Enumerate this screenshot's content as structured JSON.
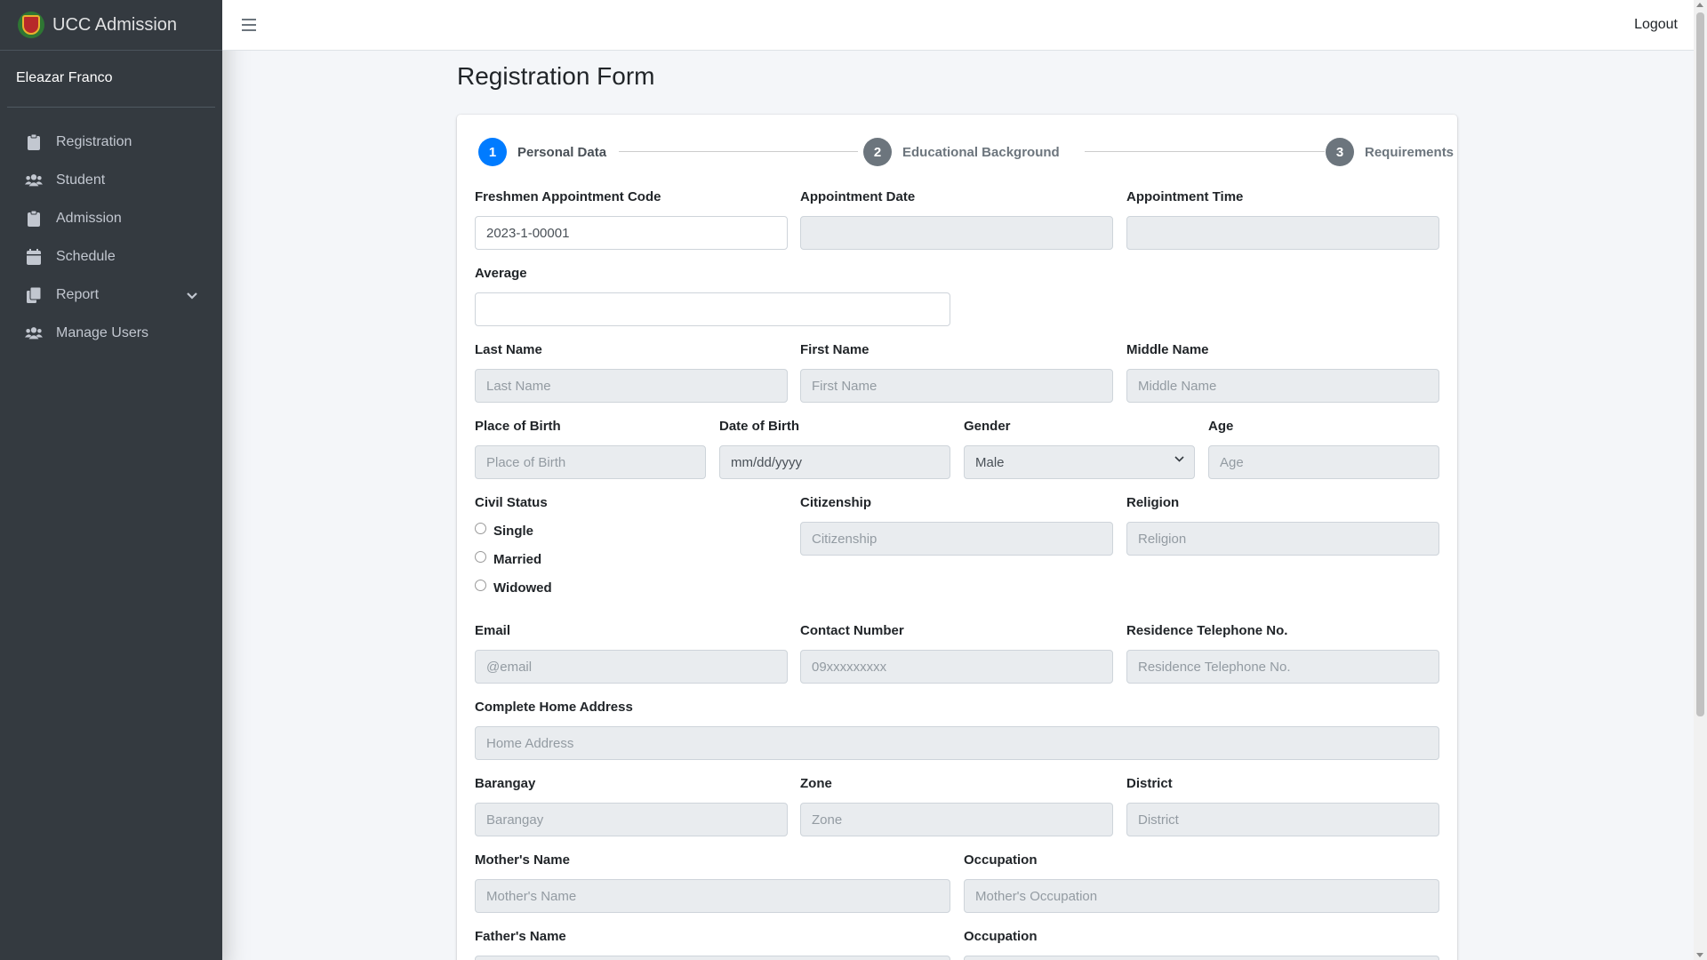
{
  "brand": {
    "title": "UCC Admission"
  },
  "user": {
    "name": "Eleazar Franco"
  },
  "sidebar": {
    "items": [
      {
        "label": "Registration",
        "icon": "clipboard-icon"
      },
      {
        "label": "Student",
        "icon": "users-icon"
      },
      {
        "label": "Admission",
        "icon": "clipboard-icon"
      },
      {
        "label": "Schedule",
        "icon": "calendar-icon"
      },
      {
        "label": "Report",
        "icon": "copy-icon"
      },
      {
        "label": "Manage Users",
        "icon": "users-icon"
      }
    ]
  },
  "topbar": {
    "logout_label": "Logout"
  },
  "page": {
    "title": "Registration Form"
  },
  "stepper": {
    "steps": [
      {
        "number": "1",
        "label": "Personal Data"
      },
      {
        "number": "2",
        "label": "Educational Background"
      },
      {
        "number": "3",
        "label": "Requirements"
      }
    ]
  },
  "form": {
    "appointment_code": {
      "label": "Freshmen Appointment Code",
      "value": "2023-1-00001"
    },
    "appointment_date": {
      "label": "Appointment Date",
      "value": ""
    },
    "appointment_time": {
      "label": "Appointment Time",
      "value": ""
    },
    "average": {
      "label": "Average",
      "value": ""
    },
    "last_name": {
      "label": "Last Name",
      "placeholder": "Last Name"
    },
    "first_name": {
      "label": "First Name",
      "placeholder": "First Name"
    },
    "middle_name": {
      "label": "Middle Name",
      "placeholder": "Middle Name"
    },
    "place_of_birth": {
      "label": "Place of Birth",
      "placeholder": "Place of Birth"
    },
    "date_of_birth": {
      "label": "Date of Birth",
      "placeholder": "mm/dd/yyyy"
    },
    "gender": {
      "label": "Gender",
      "value": "Male"
    },
    "age": {
      "label": "Age",
      "placeholder": "Age"
    },
    "civil_status": {
      "label": "Civil Status",
      "options": [
        "Single",
        "Married",
        "Widowed"
      ]
    },
    "citizenship": {
      "label": "Citizenship",
      "placeholder": "Citizenship"
    },
    "religion": {
      "label": "Religion",
      "placeholder": "Religion"
    },
    "email": {
      "label": "Email",
      "placeholder": "@email"
    },
    "contact_number": {
      "label": "Contact Number",
      "placeholder": "09xxxxxxxxx"
    },
    "residence_tel": {
      "label": "Residence Telephone No.",
      "placeholder": "Residence Telephone No."
    },
    "home_address": {
      "label": "Complete Home Address",
      "placeholder": "Home Address"
    },
    "barangay": {
      "label": "Barangay",
      "placeholder": "Barangay"
    },
    "zone": {
      "label": "Zone",
      "placeholder": "Zone"
    },
    "district": {
      "label": "District",
      "placeholder": "District"
    },
    "mothers_name": {
      "label": "Mother's Name",
      "placeholder": "Mother's Name"
    },
    "mothers_occupation": {
      "label": "Occupation",
      "placeholder": "Mother's Occupation"
    },
    "fathers_name": {
      "label": "Father's Name",
      "placeholder": ""
    },
    "fathers_occupation": {
      "label": "Occupation",
      "placeholder": ""
    }
  },
  "colors": {
    "sidebar_bg": "#343a40",
    "active_step": "#007bff",
    "inactive_step": "#6c757d"
  }
}
